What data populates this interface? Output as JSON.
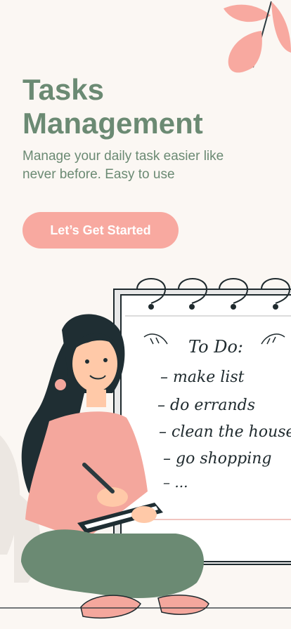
{
  "app": {
    "title_line1": "Tasks",
    "title_line2": "Management",
    "subtitle": "Manage your daily task easier like never before. Easy to use",
    "cta_label": "Let’s Get Started"
  },
  "todo": {
    "heading": "To Do:",
    "items": [
      "make list",
      "do errands",
      "clean the house",
      "go shopping",
      "..."
    ]
  },
  "colors": {
    "accent": "#f8a9a0",
    "primary_green": "#6b8a73",
    "background": "#fbf7f3",
    "dark": "#1f2a2e"
  },
  "icons": [
    "leaf-decoration",
    "notebook-spiral",
    "girl-illustration"
  ]
}
